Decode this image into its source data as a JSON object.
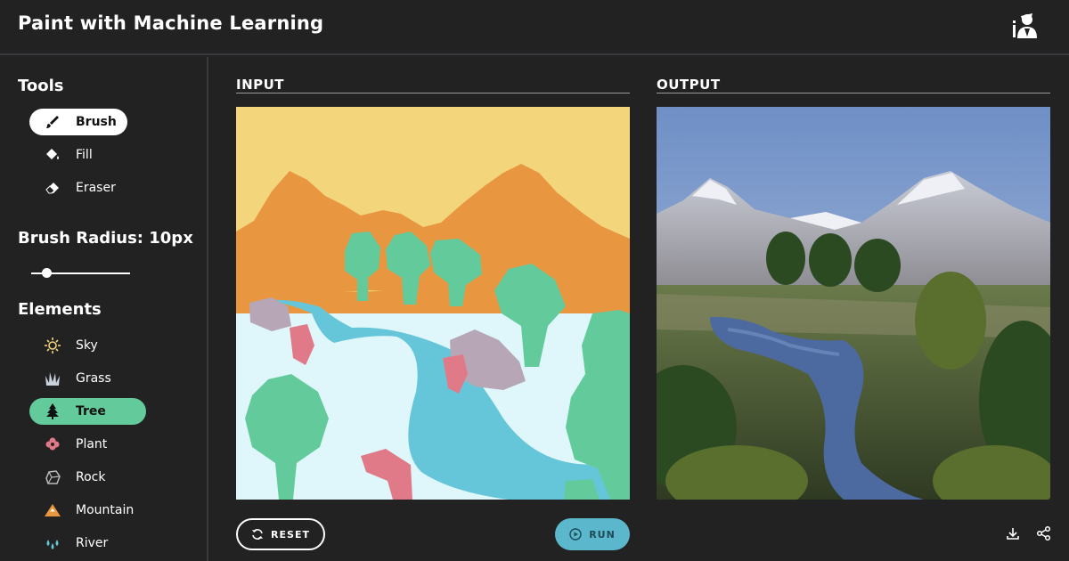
{
  "app": {
    "title": "Paint with Machine Learning"
  },
  "sidebar": {
    "tools_title": "Tools",
    "tools": [
      {
        "label": "Brush",
        "icon": "brush-icon",
        "active": true
      },
      {
        "label": "Fill",
        "icon": "fill-icon",
        "active": false
      },
      {
        "label": "Eraser",
        "icon": "eraser-icon",
        "active": false
      }
    ],
    "brush_radius_label": "Brush Radius: 10px",
    "brush_radius_value": 10,
    "elements_title": "Elements",
    "elements": [
      {
        "label": "Sky",
        "icon": "sun-icon",
        "color": "#f3d57c",
        "active": false
      },
      {
        "label": "Grass",
        "icon": "grass-icon",
        "color": "#c9d3dc",
        "active": false
      },
      {
        "label": "Tree",
        "icon": "tree-icon",
        "color": "#63cb9b",
        "active": true
      },
      {
        "label": "Plant",
        "icon": "flower-icon",
        "color": "#e07a88",
        "active": false
      },
      {
        "label": "Rock",
        "icon": "rock-icon",
        "color": "#bbbbbb",
        "active": false
      },
      {
        "label": "Mountain",
        "icon": "mountain-icon",
        "color": "#e8963f",
        "active": false
      },
      {
        "label": "River",
        "icon": "water-drops-icon",
        "color": "#66c6d9",
        "active": false
      }
    ]
  },
  "input_panel": {
    "label": "INPUT",
    "reset_label": "RESET",
    "run_label": "RUN"
  },
  "output_panel": {
    "label": "OUTPUT"
  },
  "colors": {
    "accent_tree": "#63cb9b",
    "run_button": "#5bb7cc",
    "background": "#222222"
  }
}
